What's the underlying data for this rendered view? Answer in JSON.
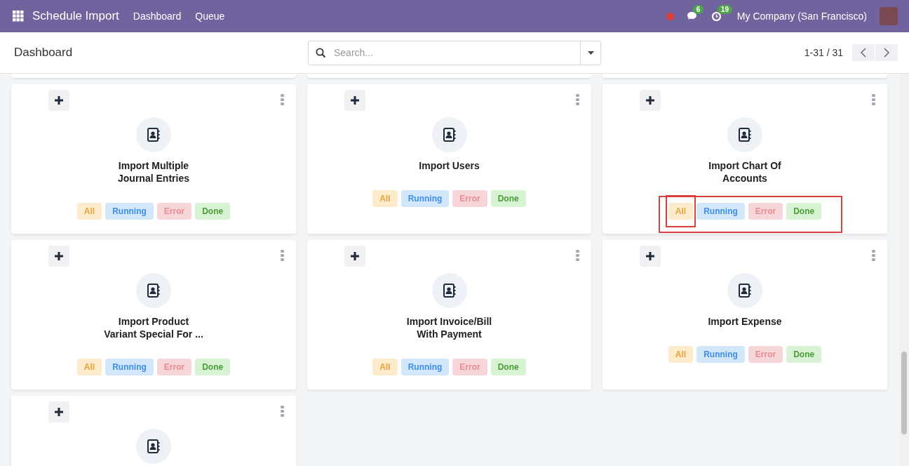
{
  "navbar": {
    "app_title": "Schedule Import",
    "menu": [
      {
        "label": "Dashboard"
      },
      {
        "label": "Queue"
      }
    ],
    "chat_count": "6",
    "activity_count": "19",
    "company": "My Company (San Francisco)"
  },
  "control_panel": {
    "title": "Dashboard",
    "search": {
      "placeholder": "Search..."
    },
    "pager": "1-31 / 31"
  },
  "cards": [
    {
      "title": "Import Multiple\nJournal Entries",
      "highlighted": false,
      "badges": [
        {
          "kind": "all",
          "label": "All",
          "highlighted": false
        },
        {
          "kind": "running",
          "label": "Running",
          "highlighted": false
        },
        {
          "kind": "error",
          "label": "Error",
          "highlighted": false
        },
        {
          "kind": "done",
          "label": "Done",
          "highlighted": false
        }
      ]
    },
    {
      "title": "Import Users",
      "highlighted": false,
      "badges": [
        {
          "kind": "all",
          "label": "All",
          "highlighted": false
        },
        {
          "kind": "running",
          "label": "Running",
          "highlighted": false
        },
        {
          "kind": "error",
          "label": "Error",
          "highlighted": false
        },
        {
          "kind": "done",
          "label": "Done",
          "highlighted": false
        }
      ]
    },
    {
      "title": "Import Chart Of\nAccounts",
      "highlighted": true,
      "badges": [
        {
          "kind": "all",
          "label": "All",
          "highlighted": true
        },
        {
          "kind": "running",
          "label": "Running",
          "highlighted": false
        },
        {
          "kind": "error",
          "label": "Error",
          "highlighted": false
        },
        {
          "kind": "done",
          "label": "Done",
          "highlighted": false
        }
      ]
    },
    {
      "title": "Import Product\nVariant Special For ...",
      "highlighted": false,
      "badges": [
        {
          "kind": "all",
          "label": "All",
          "highlighted": false
        },
        {
          "kind": "running",
          "label": "Running",
          "highlighted": false
        },
        {
          "kind": "error",
          "label": "Error",
          "highlighted": false
        },
        {
          "kind": "done",
          "label": "Done",
          "highlighted": false
        }
      ]
    },
    {
      "title": "Import Invoice/Bill\nWith Payment",
      "highlighted": false,
      "badges": [
        {
          "kind": "all",
          "label": "All",
          "highlighted": false
        },
        {
          "kind": "running",
          "label": "Running",
          "highlighted": false
        },
        {
          "kind": "error",
          "label": "Error",
          "highlighted": false
        },
        {
          "kind": "done",
          "label": "Done",
          "highlighted": false
        }
      ]
    },
    {
      "title": "Import Expense",
      "highlighted": false,
      "badges": [
        {
          "kind": "all",
          "label": "All",
          "highlighted": false
        },
        {
          "kind": "running",
          "label": "Running",
          "highlighted": false
        },
        {
          "kind": "error",
          "label": "Error",
          "highlighted": false
        },
        {
          "kind": "done",
          "label": "Done",
          "highlighted": false
        }
      ]
    },
    {
      "highlighted": false
    }
  ]
}
